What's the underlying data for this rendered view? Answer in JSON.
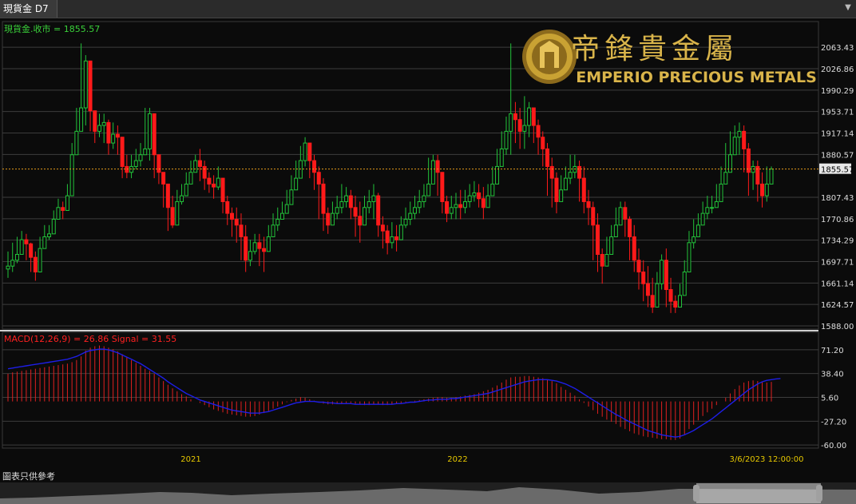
{
  "window": {
    "tab_title": "現貨金 D7",
    "menu_icon": "triangle-down-icon"
  },
  "logo": {
    "brand_cn": "帝鋒貴金屬",
    "brand_en": "EMPERIO PRECIOUS METALS",
    "mark": "gold circular emblem"
  },
  "disclaimer": "圖表只供參考",
  "colors": {
    "up": "#22c33a",
    "down": "#ff1a1a",
    "signal": "#1e1ee6",
    "macd_label": "#ff2020",
    "price_label": "#3ad13a",
    "axis_text": "#dddddd",
    "last_price_line": "#e39a1a",
    "date_text": "#e6c800"
  },
  "chart_data": [
    {
      "type": "candlestick",
      "legend": "現貨金.收市 = 1855.57",
      "ylim": [
        1588.0,
        2080.0
      ],
      "y_ticks": [
        "2063.43",
        "2026.86",
        "1990.29",
        "1953.71",
        "1917.14",
        "1880.57",
        "1807.43",
        "1770.86",
        "1734.29",
        "1697.71",
        "1661.14",
        "1624.57",
        "1588.00"
      ],
      "last_price": "1855.57",
      "x_labels": [
        "2021",
        "2022",
        "3/6/2023 12:00:00"
      ],
      "close": [
        1690,
        1700,
        1710,
        1735,
        1728,
        1705,
        1680,
        1720,
        1740,
        1745,
        1770,
        1790,
        1785,
        1810,
        1880,
        1920,
        1960,
        2040,
        1955,
        1920,
        1930,
        1935,
        1900,
        1915,
        1910,
        1860,
        1850,
        1860,
        1870,
        1880,
        1890,
        1950,
        1880,
        1850,
        1830,
        1790,
        1760,
        1800,
        1810,
        1830,
        1850,
        1870,
        1860,
        1840,
        1830,
        1825,
        1840,
        1800,
        1780,
        1770,
        1760,
        1740,
        1700,
        1715,
        1730,
        1720,
        1715,
        1740,
        1760,
        1770,
        1780,
        1795,
        1820,
        1840,
        1870,
        1900,
        1870,
        1850,
        1830,
        1780,
        1760,
        1780,
        1790,
        1800,
        1810,
        1790,
        1775,
        1760,
        1790,
        1800,
        1810,
        1760,
        1750,
        1730,
        1740,
        1735,
        1760,
        1770,
        1780,
        1790,
        1800,
        1810,
        1830,
        1870,
        1850,
        1800,
        1780,
        1790,
        1795,
        1790,
        1800,
        1810,
        1815,
        1805,
        1790,
        1810,
        1830,
        1860,
        1890,
        1920,
        1950,
        1940,
        1920,
        1930,
        1960,
        1930,
        1910,
        1890,
        1860,
        1840,
        1800,
        1820,
        1840,
        1850,
        1860,
        1840,
        1800,
        1790,
        1760,
        1710,
        1690,
        1710,
        1740,
        1760,
        1790,
        1770,
        1740,
        1700,
        1680,
        1660,
        1640,
        1620,
        1660,
        1700,
        1650,
        1630,
        1620,
        1640,
        1680,
        1730,
        1740,
        1760,
        1780,
        1790,
        1790,
        1800,
        1830,
        1850,
        1880,
        1910,
        1920,
        1890,
        1850,
        1860,
        1830,
        1810,
        1830,
        1855.57
      ],
      "high": [
        1715,
        1730,
        1740,
        1750,
        1745,
        1730,
        1715,
        1740,
        1760,
        1760,
        1785,
        1805,
        1800,
        1830,
        1900,
        1960,
        2070,
        2050,
        1990,
        1955,
        1950,
        1950,
        1940,
        1935,
        1930,
        1900,
        1880,
        1880,
        1890,
        1900,
        1960,
        1960,
        1900,
        1870,
        1850,
        1830,
        1810,
        1820,
        1830,
        1850,
        1870,
        1880,
        1890,
        1870,
        1850,
        1845,
        1860,
        1840,
        1810,
        1790,
        1790,
        1780,
        1760,
        1735,
        1745,
        1745,
        1740,
        1760,
        1780,
        1790,
        1800,
        1820,
        1845,
        1870,
        1895,
        1910,
        1900,
        1880,
        1860,
        1840,
        1790,
        1800,
        1810,
        1830,
        1825,
        1820,
        1810,
        1800,
        1810,
        1820,
        1830,
        1815,
        1775,
        1760,
        1765,
        1760,
        1775,
        1790,
        1800,
        1810,
        1820,
        1830,
        1875,
        1880,
        1880,
        1850,
        1810,
        1810,
        1815,
        1820,
        1820,
        1830,
        1835,
        1830,
        1825,
        1830,
        1860,
        1890,
        1920,
        1945,
        2070,
        1970,
        1960,
        1980,
        1970,
        1960,
        1940,
        1920,
        1900,
        1875,
        1850,
        1845,
        1860,
        1880,
        1880,
        1870,
        1860,
        1820,
        1800,
        1780,
        1720,
        1740,
        1760,
        1790,
        1800,
        1800,
        1775,
        1760,
        1720,
        1700,
        1690,
        1670,
        1680,
        1710,
        1720,
        1670,
        1640,
        1660,
        1700,
        1750,
        1770,
        1780,
        1800,
        1810,
        1810,
        1830,
        1860,
        1900,
        1920,
        1930,
        1935,
        1930,
        1900,
        1870,
        1870,
        1850,
        1860,
        1860
      ],
      "low": [
        1670,
        1680,
        1695,
        1710,
        1700,
        1680,
        1665,
        1705,
        1725,
        1735,
        1755,
        1770,
        1770,
        1800,
        1860,
        1900,
        1920,
        1930,
        1920,
        1900,
        1910,
        1900,
        1880,
        1890,
        1880,
        1840,
        1840,
        1840,
        1855,
        1860,
        1880,
        1870,
        1840,
        1830,
        1790,
        1750,
        1755,
        1785,
        1795,
        1810,
        1830,
        1850,
        1835,
        1820,
        1815,
        1805,
        1820,
        1780,
        1760,
        1740,
        1730,
        1700,
        1680,
        1690,
        1710,
        1690,
        1680,
        1720,
        1740,
        1750,
        1770,
        1780,
        1800,
        1825,
        1850,
        1860,
        1840,
        1820,
        1770,
        1750,
        1745,
        1760,
        1770,
        1780,
        1790,
        1770,
        1740,
        1730,
        1760,
        1780,
        1770,
        1740,
        1720,
        1710,
        1720,
        1715,
        1740,
        1755,
        1760,
        1770,
        1780,
        1790,
        1810,
        1840,
        1810,
        1780,
        1765,
        1770,
        1770,
        1770,
        1780,
        1790,
        1800,
        1790,
        1770,
        1790,
        1810,
        1840,
        1860,
        1880,
        1880,
        1900,
        1890,
        1890,
        1910,
        1900,
        1880,
        1860,
        1810,
        1790,
        1780,
        1800,
        1820,
        1830,
        1840,
        1800,
        1780,
        1760,
        1700,
        1680,
        1660,
        1690,
        1720,
        1740,
        1760,
        1740,
        1700,
        1680,
        1650,
        1630,
        1620,
        1610,
        1640,
        1650,
        1620,
        1610,
        1610,
        1620,
        1660,
        1710,
        1720,
        1740,
        1760,
        1770,
        1780,
        1790,
        1810,
        1840,
        1860,
        1880,
        1880,
        1850,
        1810,
        1820,
        1800,
        1790,
        1800,
        1840
      ],
      "volume_hidden": false
    },
    {
      "type": "bar+line",
      "legend": "MACD(12,26,9) = 26.86 Signal = 31.55",
      "ylim": [
        -62.0,
        82.0
      ],
      "y_ticks": [
        "71.20",
        "38.40",
        "5.60",
        "-27.20",
        "-60.00"
      ],
      "macd": [
        38,
        40,
        41,
        42,
        43,
        44,
        45,
        46,
        47,
        48,
        49,
        50,
        51,
        52,
        54,
        57,
        62,
        70,
        74,
        76,
        77,
        76,
        74,
        72,
        69,
        65,
        61,
        57,
        53,
        49,
        45,
        42,
        38,
        33,
        28,
        23,
        18,
        14,
        10,
        7,
        3,
        0,
        -2,
        -5,
        -8,
        -11,
        -13,
        -15,
        -17,
        -18,
        -19,
        -20,
        -21,
        -21,
        -20,
        -18,
        -16,
        -13,
        -10,
        -7,
        -4,
        -1,
        2,
        4,
        6,
        5,
        3,
        1,
        -1,
        -3,
        -4,
        -4,
        -3,
        -3,
        -2,
        -2,
        -3,
        -4,
        -5,
        -5,
        -4,
        -4,
        -5,
        -5,
        -4,
        -3,
        -2,
        -1,
        0,
        1,
        2,
        3,
        4,
        5,
        6,
        6,
        5,
        5,
        6,
        7,
        8,
        9,
        10,
        12,
        14,
        16,
        19,
        22,
        26,
        30,
        33,
        34,
        34,
        35,
        35,
        34,
        33,
        32,
        30,
        28,
        25,
        20,
        16,
        12,
        8,
        3,
        -2,
        -7,
        -12,
        -17,
        -21,
        -25,
        -28,
        -31,
        -35,
        -38,
        -41,
        -44,
        -46,
        -48,
        -49,
        -50,
        -51,
        -52,
        -52,
        -53,
        -53,
        -51,
        -45,
        -38,
        -32,
        -26,
        -20,
        -15,
        -10,
        -5,
        0,
        5,
        11,
        17,
        22,
        26,
        28,
        29,
        28,
        27,
        26,
        26.86
      ],
      "signal": [
        45,
        46,
        47,
        48,
        49,
        50,
        51,
        52,
        53,
        54,
        55,
        56,
        57,
        58,
        60,
        62,
        65,
        68,
        70,
        71,
        72,
        72,
        71,
        69,
        67,
        64,
        61,
        58,
        55,
        52,
        48,
        44,
        40,
        36,
        32,
        27,
        23,
        19,
        15,
        11,
        8,
        5,
        2,
        0,
        -2,
        -4,
        -6,
        -8,
        -10,
        -12,
        -13,
        -14,
        -15,
        -16,
        -16,
        -16,
        -15,
        -14,
        -12,
        -10,
        -8,
        -6,
        -4,
        -2,
        -1,
        0,
        0,
        0,
        -1,
        -1,
        -2,
        -2,
        -3,
        -3,
        -3,
        -3,
        -4,
        -4,
        -4,
        -4,
        -4,
        -4,
        -4,
        -4,
        -4,
        -3,
        -3,
        -2,
        -1,
        -1,
        0,
        1,
        2,
        2,
        3,
        3,
        3,
        4,
        4,
        5,
        6,
        7,
        8,
        9,
        10,
        11,
        13,
        15,
        17,
        19,
        21,
        23,
        25,
        27,
        28,
        29,
        30,
        30,
        30,
        29,
        28,
        26,
        24,
        21,
        18,
        14,
        10,
        6,
        2,
        -2,
        -6,
        -10,
        -14,
        -18,
        -21,
        -25,
        -28,
        -31,
        -34,
        -37,
        -40,
        -42,
        -44,
        -46,
        -47,
        -48,
        -49,
        -48,
        -46,
        -43,
        -40,
        -36,
        -32,
        -28,
        -24,
        -19,
        -14,
        -9,
        -4,
        1,
        6,
        11,
        16,
        20,
        24,
        27,
        29,
        30,
        31,
        31.55
      ]
    }
  ]
}
